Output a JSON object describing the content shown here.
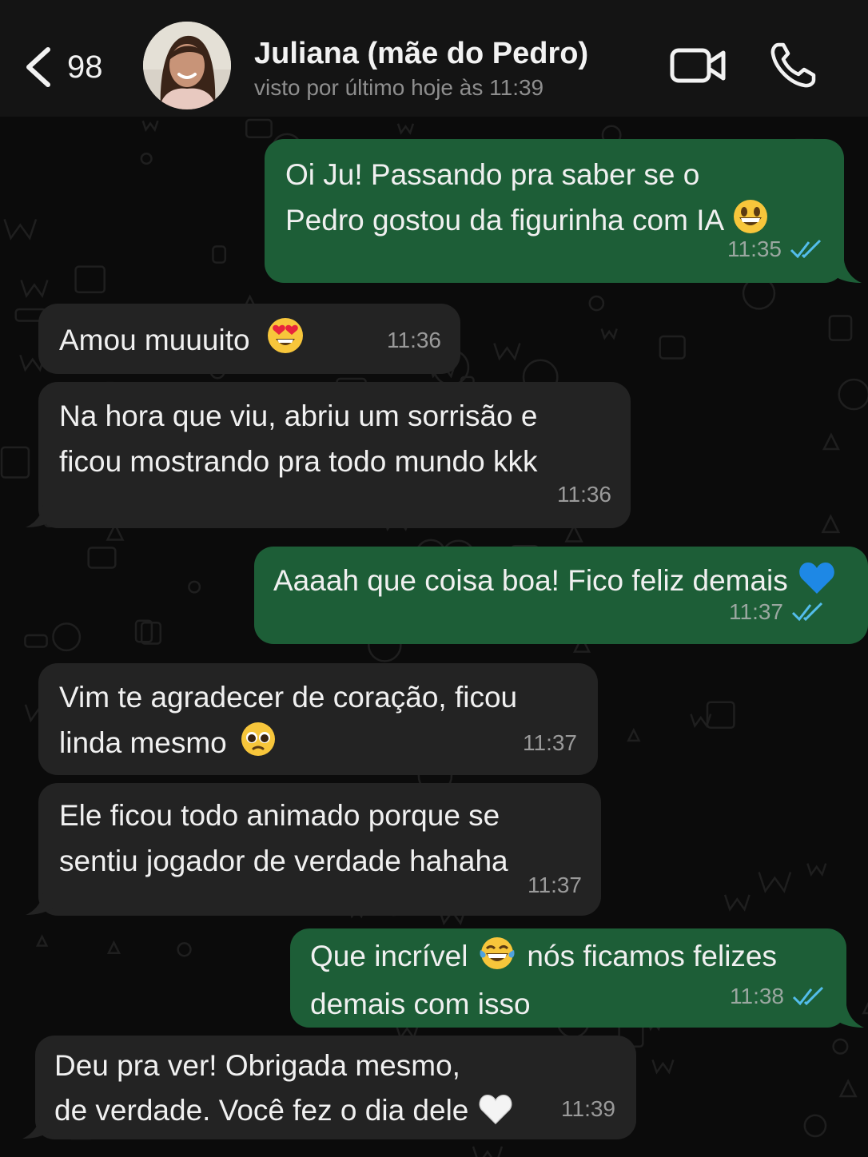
{
  "header": {
    "back_count": "98",
    "contact_name": "Juliana (mãe do Pedro)",
    "contact_status": "visto por último hoje às 11:39"
  },
  "colors": {
    "incoming_bubble": "#232323",
    "outgoing_bubble": "#1d5e37",
    "read_ticks": "#53bdeb",
    "header_bg": "#141414"
  },
  "messages": [
    {
      "direction": "out",
      "text": "Oi Ju! Passando pra saber se o\nPedro gostou da figurinha com IA",
      "emoji": "grinning-face",
      "time": "11:35",
      "status": "read"
    },
    {
      "direction": "in",
      "text": "Amou muuuito",
      "emoji": "heart-eyes-face",
      "time": "11:36"
    },
    {
      "direction": "in",
      "text": "Na hora que viu, abriu um sorrisão e\nficou mostrando pra todo mundo kkk",
      "time": "11:36"
    },
    {
      "direction": "out",
      "text": "Aaaah que coisa boa! Fico feliz demais",
      "emoji": "blue-heart",
      "time": "11:37",
      "status": "read"
    },
    {
      "direction": "in",
      "text": "Vim te agradecer de coração, ficou\nlinda mesmo",
      "emoji": "pleading-face",
      "time": "11:37"
    },
    {
      "direction": "in",
      "text": "Ele ficou todo animado porque se\nsentiu jogador de verdade hahaha",
      "time": "11:37"
    },
    {
      "direction": "out",
      "text_a": "Que incrível",
      "emoji": "tears-of-joy-face",
      "text_b": "nós ficamos felizes\ndemais com isso",
      "time": "11:38",
      "status": "read"
    },
    {
      "direction": "in",
      "text": "Deu pra ver! Obrigada mesmo,\nde verdade. Você fez o dia dele",
      "emoji": "white-heart",
      "time": "11:39"
    }
  ]
}
